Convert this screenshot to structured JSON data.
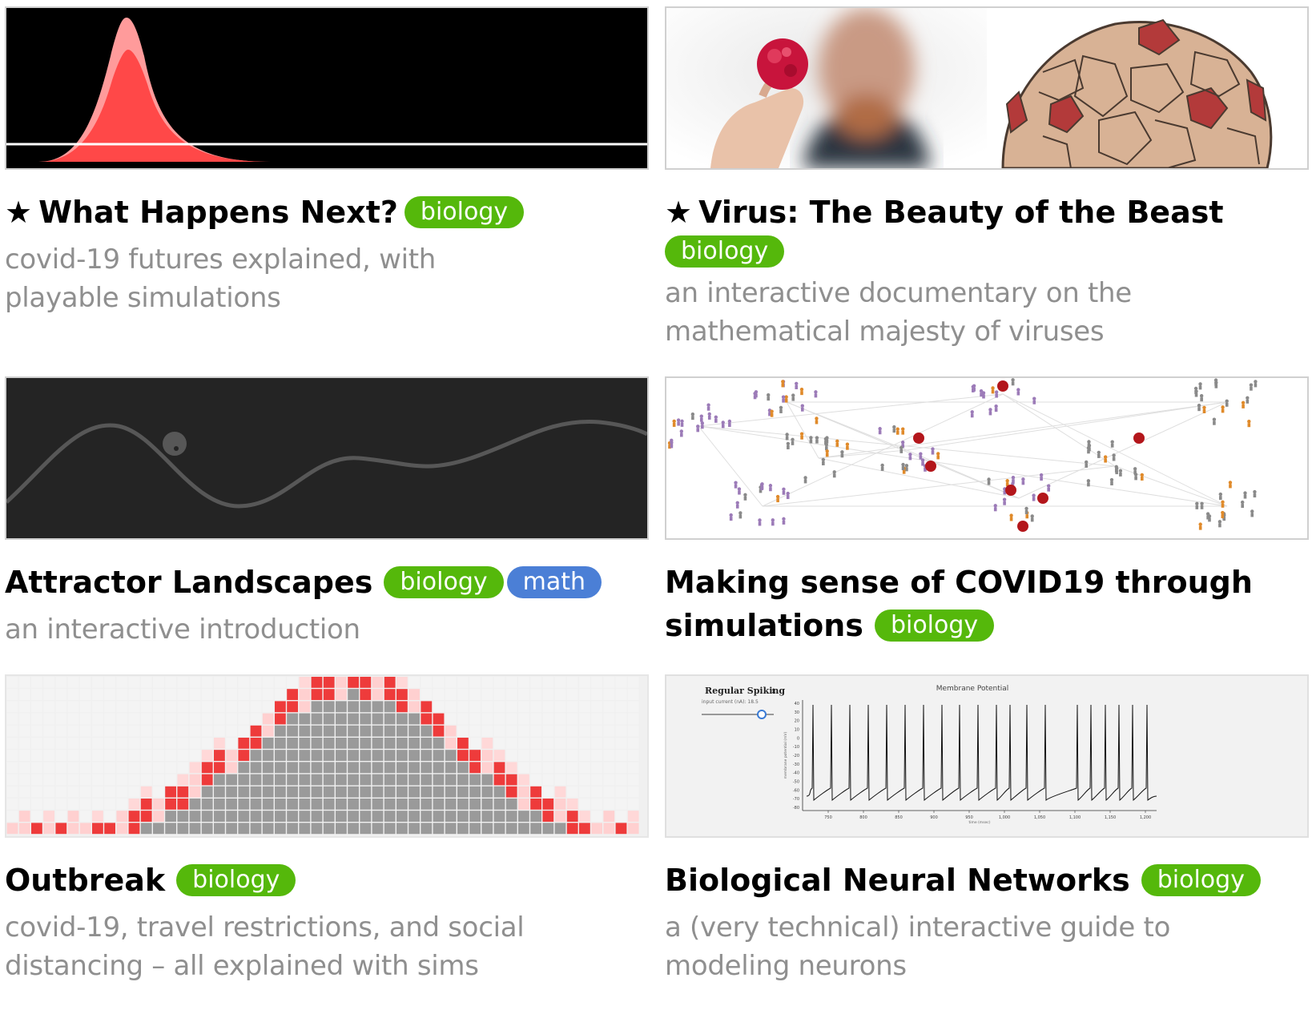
{
  "cards": [
    {
      "starred": "★",
      "title": "What Happens Next?",
      "tags": [
        "biology"
      ],
      "description": "covid-19 futures explained, with playable simulations"
    },
    {
      "starred": "★",
      "title": "Virus: The Beauty of the Beast",
      "tags": [
        "biology"
      ],
      "description": "an interactive documentary on the mathematical majesty of viruses"
    },
    {
      "title": "Attractor Landscapes",
      "tags": [
        "biology",
        "math"
      ],
      "description": "an interactive introduction"
    },
    {
      "title": "Making sense of COVID19 through simulations",
      "tags": [
        "biology"
      ],
      "description": ""
    },
    {
      "title": "Outbreak",
      "tags": [
        "biology"
      ],
      "description": "covid-19, travel restrictions, and social distancing – all explained with sims"
    },
    {
      "title": "Biological Neural Networks",
      "tags": [
        "biology"
      ],
      "description": "a (very technical) interactive guide to modeling neurons",
      "thumb": {
        "dropdown_label": "Regular Spiking",
        "input_label": "input current (nA): 18.5",
        "plot_title": "Membrane Potential",
        "y_axis_label": "membrane potential (mV)",
        "x_axis_label": "time (msec)",
        "y_ticks": [
          "40",
          "30",
          "20",
          "10",
          "0",
          "-10",
          "-20",
          "-30",
          "-40",
          "-50",
          "-60",
          "-70",
          "-80"
        ],
        "x_ticks": [
          "750",
          "800",
          "850",
          "900",
          "950",
          "1,000",
          "1,050",
          "1,100",
          "1,150",
          "1,200"
        ]
      }
    }
  ],
  "colors": {
    "biology_tag": "#55b80b",
    "math_tag": "#4b7fd6",
    "description_text": "#8f8f8f"
  }
}
